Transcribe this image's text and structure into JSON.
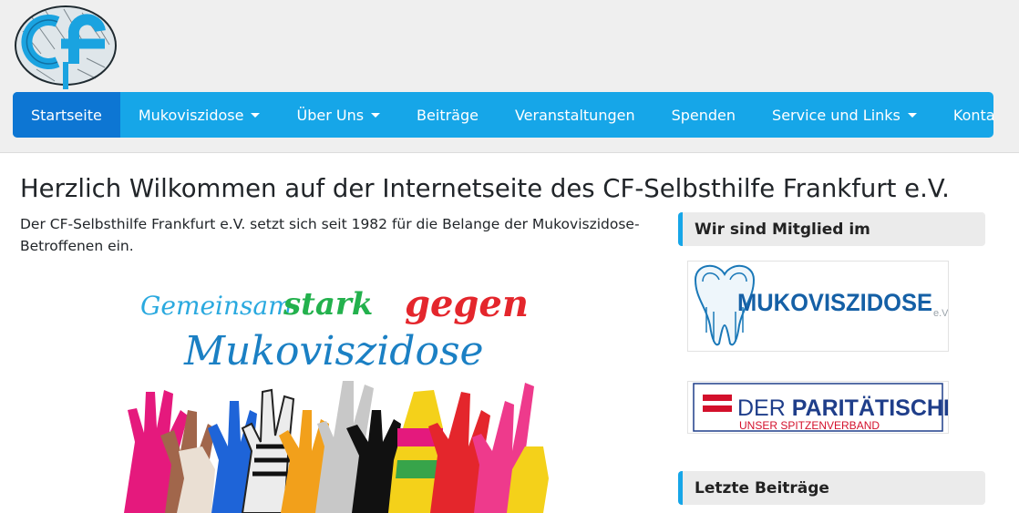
{
  "site": {
    "logo_text": "cf"
  },
  "nav": {
    "items": [
      {
        "label": "Startseite",
        "dropdown": false,
        "active": true
      },
      {
        "label": "Mukoviszidose",
        "dropdown": true,
        "active": false
      },
      {
        "label": "Über Uns",
        "dropdown": true,
        "active": false
      },
      {
        "label": "Beiträge",
        "dropdown": false,
        "active": false
      },
      {
        "label": "Veranstaltungen",
        "dropdown": false,
        "active": false
      },
      {
        "label": "Spenden",
        "dropdown": false,
        "active": false
      },
      {
        "label": "Service und Links",
        "dropdown": true,
        "active": false
      },
      {
        "label": "Kontakt",
        "dropdown": false,
        "active": false
      }
    ]
  },
  "main": {
    "title": "Herzlich Wilkommen auf der Internetseite des CF-Selbsthilfe Frankfurt e.V.",
    "intro": "Der CF-Selbsthilfe Frankfurt e.V. setzt sich seit 1982 für die Belange der Mukoviszidose-Betroffenen ein.",
    "hero": {
      "line1_a": "Gemeinsam",
      "line1_b": "stark",
      "line1_c": "gegen",
      "line2": "Mukoviszidose"
    }
  },
  "sidebar": {
    "member_title": "Wir sind Mitglied im",
    "partner1": {
      "name": "MUKOVISZIDOSE",
      "suffix": "e.V."
    },
    "partner2": {
      "name_a": "DER ",
      "name_b": "PARITÄTISCHE",
      "tagline": "UNSER SPITZENVERBAND"
    },
    "recent_title": "Letzte Beiträge"
  },
  "colors": {
    "nav_bg": "#16a6e8",
    "nav_active": "#0d76d3",
    "accent": "#16a6e8",
    "paritaet_red": "#d3102b",
    "paritaet_blue": "#1f3e8a"
  },
  "icons": {
    "logo": "cf-tree-logo",
    "dropdown": "caret-down-icon"
  }
}
